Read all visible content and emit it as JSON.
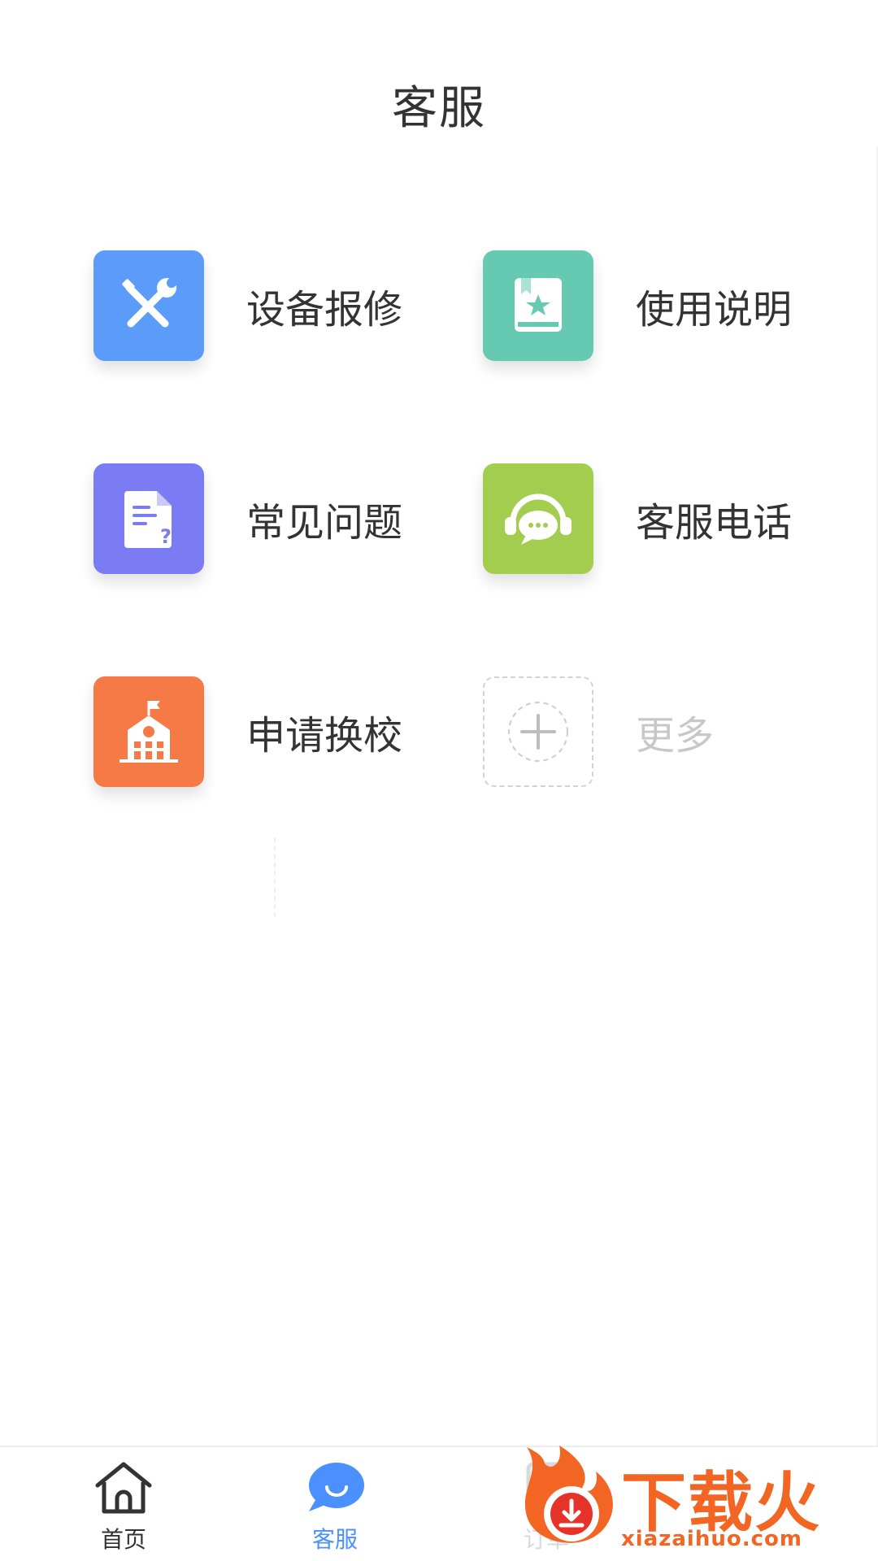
{
  "header": {
    "title": "客服"
  },
  "tiles": [
    {
      "label": "设备报修",
      "color": "#5b9bfa",
      "icon": "wrench-screwdriver-icon"
    },
    {
      "label": "使用说明",
      "color": "#66c9b2",
      "icon": "book-star-icon"
    },
    {
      "label": "常见问题",
      "color": "#7b7cf3",
      "icon": "document-question-icon"
    },
    {
      "label": "客服电话",
      "color": "#a3cd4f",
      "icon": "headset-chat-icon"
    },
    {
      "label": "申请换校",
      "color": "#f57a45",
      "icon": "school-building-icon"
    },
    {
      "label": "更多",
      "color": "#d3d3d3",
      "icon": "plus-circle-icon"
    }
  ],
  "tabbar": {
    "tabs": [
      {
        "label": "首页",
        "icon": "home-icon",
        "active": false
      },
      {
        "label": "客服",
        "icon": "chat-smile-icon",
        "active": true
      },
      {
        "label": "订单",
        "icon": "order-icon",
        "active": false
      }
    ],
    "active_color": "#4a90ff"
  },
  "watermark": {
    "brand": "下载火",
    "url": "xiazaihuo.com"
  }
}
